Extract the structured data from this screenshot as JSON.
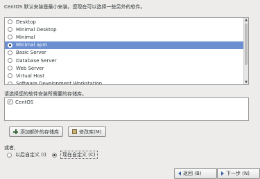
{
  "intro_text": "CentOS 默认安装是最小安装。您现在可以选择一些另外的软件。",
  "packages": [
    {
      "label": "Desktop",
      "selected": false
    },
    {
      "label": "Minimal Desktop",
      "selected": false
    },
    {
      "label": "Minimal",
      "selected": false
    },
    {
      "label": "Minimal apm",
      "selected": true
    },
    {
      "label": "Basic Server",
      "selected": false
    },
    {
      "label": "Database Server",
      "selected": false
    },
    {
      "label": "Web Server",
      "selected": false
    },
    {
      "label": "Virtual Host",
      "selected": false
    },
    {
      "label": "Software Development Workstation",
      "selected": false
    }
  ],
  "repo_prompt": "请选择您的软件安装所需要的存储库。",
  "repos": [
    {
      "label": "CentOS",
      "checked": true
    }
  ],
  "buttons": {
    "add_repo": "添加额外的存储库",
    "modify_repo": "修改库(M)",
    "back": "返回 (B)",
    "next": "下一步 (N)"
  },
  "customize": {
    "label": "或者,",
    "later": "以后自定义 (I)",
    "now": "现在自定义 (C)",
    "selected": "now"
  },
  "colors": {
    "selection": "#6a8ed0",
    "background": "#edeceb"
  }
}
